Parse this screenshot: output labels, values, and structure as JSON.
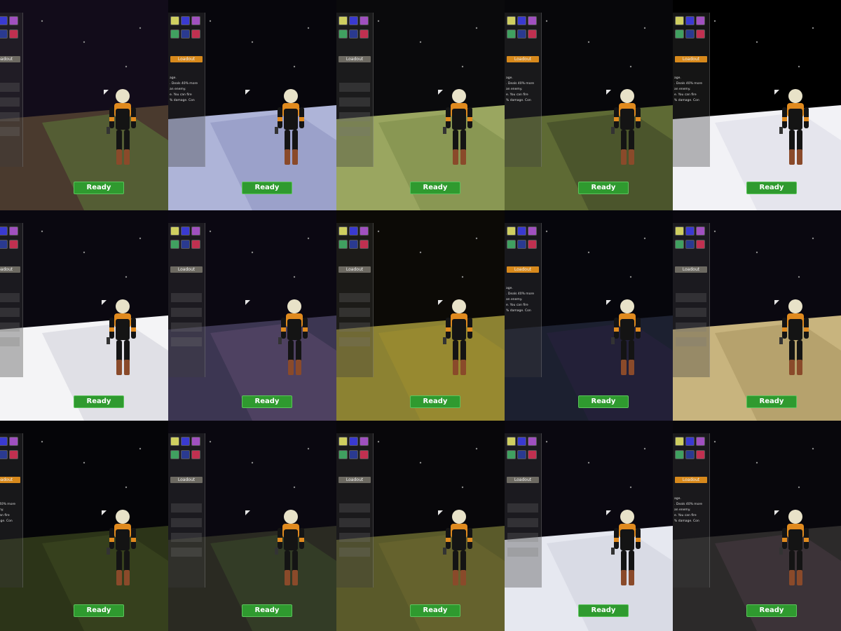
{
  "hud": {
    "ready_label": "Ready",
    "loadout_label": "Loadout",
    "desc_lines": [
      "age.",
      ". Deals 40% more",
      "an enemy.",
      "e. You can fire",
      "% damage. Con"
    ]
  },
  "colors": {
    "ready_green": "#2f9a2f",
    "loadout_orange": "#d7891c",
    "loadout_grey": "#6d6a62",
    "suit_orange": "#e08a1e",
    "suit_black": "#141414",
    "helmet": "#e8e2c8"
  },
  "tiles": [
    {
      "sky": "#120c1a",
      "ground": "#4a3a2e",
      "ground2": "#5c7a3a",
      "tab": "grey",
      "desc": false,
      "icons": [
        "#cfcf60",
        "#3a3ad0",
        "#a050c0",
        "#40a060",
        "#2a3a90",
        "#c03050"
      ]
    },
    {
      "sky": "#07060c",
      "ground": "#aeb4d8",
      "ground2": "#8c92c0",
      "tab": "orange",
      "desc": true,
      "icons": [
        "#cfcf60",
        "#3a3ad0",
        "#a050c0",
        "#40a060",
        "#2a3a90",
        "#c03050"
      ]
    },
    {
      "sky": "#0a0a0c",
      "ground": "#9aa660",
      "ground2": "#7c8a48",
      "tab": "grey",
      "desc": false,
      "icons": [
        "#cfcf60",
        "#3a3ad0",
        "#a050c0",
        "#40a060",
        "#2a3a90",
        "#c03050"
      ]
    },
    {
      "sky": "#07070a",
      "ground": "#5e6a34",
      "ground2": "#3c4426",
      "tab": "orange",
      "desc": true,
      "icons": [
        "#cfcf60",
        "#3a3ad0",
        "#a050c0",
        "#40a060",
        "#2a3a90",
        "#c03050"
      ]
    },
    {
      "sky": "#000000",
      "ground": "#f2f2f6",
      "ground2": "#dadbe6",
      "tab": "orange",
      "desc": true,
      "icons": [
        "#cfcf60",
        "#3a3ad0",
        "#a050c0",
        "#40a060",
        "#2a3a90",
        "#c03050"
      ]
    },
    {
      "sky": "#0a0810",
      "ground": "#f4f4f6",
      "ground2": "#cfd0d8",
      "tab": "grey",
      "desc": false,
      "icons": [
        "#cfcf60",
        "#3a3ad0",
        "#a050c0",
        "#40a060",
        "#2a3a90",
        "#c03050"
      ]
    },
    {
      "sky": "#0b0812",
      "ground": "#3c3652",
      "ground2": "#5c4a6e",
      "tab": "grey",
      "desc": false,
      "icons": [
        "#cfcf60",
        "#3a3ad0",
        "#a050c0",
        "#40a060",
        "#2a3a90",
        "#c03050"
      ]
    },
    {
      "sky": "#0c0a06",
      "ground": "#8c8232",
      "ground2": "#a09030",
      "tab": "grey",
      "desc": false,
      "icons": [
        "#cfcf60",
        "#3a3ad0",
        "#a050c0",
        "#40a060",
        "#2a3a90",
        "#c03050"
      ]
    },
    {
      "sky": "#06060c",
      "ground": "#1c2030",
      "ground2": "#2a2040",
      "tab": "orange",
      "desc": true,
      "icons": [
        "#cfcf60",
        "#3a3ad0",
        "#a050c0",
        "#40a060",
        "#2a3a90",
        "#c03050"
      ]
    },
    {
      "sky": "#0a0810",
      "ground": "#c8b47e",
      "ground2": "#a8935e",
      "tab": "grey",
      "desc": false,
      "icons": [
        "#cfcf60",
        "#3a3ad0",
        "#a050c0",
        "#40a060",
        "#2a3a90",
        "#c03050"
      ]
    },
    {
      "sky": "#050508",
      "ground": "#2c3418",
      "ground2": "#404a22",
      "tab": "orange",
      "desc": true,
      "icons": [
        "#cfcf60",
        "#3a3ad0",
        "#a050c0",
        "#40a060",
        "#2a3a90",
        "#c03050"
      ]
    },
    {
      "sky": "#0a0810",
      "ground": "#2a2a22",
      "ground2": "#3a4a2a",
      "tab": "grey",
      "desc": false,
      "icons": [
        "#cfcf60",
        "#3a3ad0",
        "#a050c0",
        "#40a060",
        "#2a3a90",
        "#c03050"
      ]
    },
    {
      "sky": "#08070a",
      "ground": "#5a5a2a",
      "ground2": "#706a30",
      "tab": "grey",
      "desc": false,
      "icons": [
        "#cfcf60",
        "#3a3ad0",
        "#a050c0",
        "#40a060",
        "#2a3a90",
        "#c03050"
      ]
    },
    {
      "sky": "#0a0810",
      "ground": "#e6e8f0",
      "ground2": "#cdd0dc",
      "tab": "grey",
      "desc": false,
      "icons": [
        "#cfcf60",
        "#3a3ad0",
        "#a050c0",
        "#40a060",
        "#2a3a90",
        "#c03050"
      ]
    },
    {
      "sky": "#08070c",
      "ground": "#2c2a2a",
      "ground2": "#4a3a44",
      "tab": "orange",
      "desc": true,
      "icons": [
        "#cfcf60",
        "#3a3ad0",
        "#a050c0",
        "#40a060",
        "#2a3a90",
        "#c03050"
      ]
    }
  ]
}
